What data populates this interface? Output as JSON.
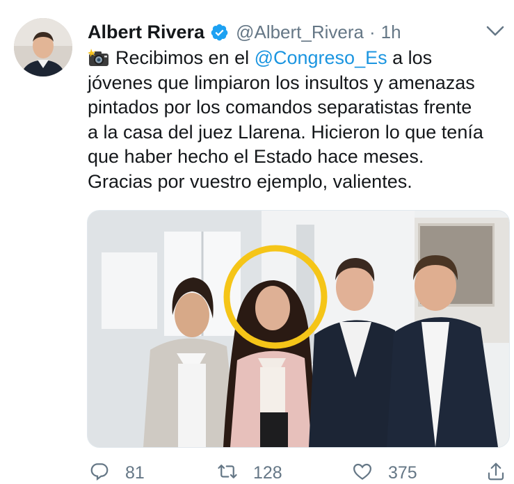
{
  "author": {
    "display_name": "Albert Rivera",
    "handle": "@Albert_Rivera",
    "separator": "·",
    "time": "1h",
    "verified": true
  },
  "tweet": {
    "lines": [
      {
        "before": "Recibimos en el ",
        "mention": "@Congreso_Es",
        "after": " a los"
      },
      "jóvenes que limpiaron los insultos y amenazas",
      "pintados por los comandos separatistas frente",
      "a la casa del juez Llarena. Hicieron lo que tenía",
      "que haber hecho el Estado hace meses.",
      "Gracias por vuestro ejemplo, valientes."
    ],
    "leading_emoji": "camera-flash-icon"
  },
  "actions": {
    "reply_count": "81",
    "retweet_count": "128",
    "like_count": "375"
  },
  "colors": {
    "link": "#1b95e0",
    "secondary_text": "#657786",
    "verified_badge": "#1da1f2",
    "highlight_circle": "#f5c518"
  },
  "icons": {
    "verified": "verified-badge-icon",
    "menu": "chevron-down-icon",
    "reply": "reply-icon",
    "retweet": "retweet-icon",
    "like": "heart-icon",
    "share": "share-icon"
  }
}
